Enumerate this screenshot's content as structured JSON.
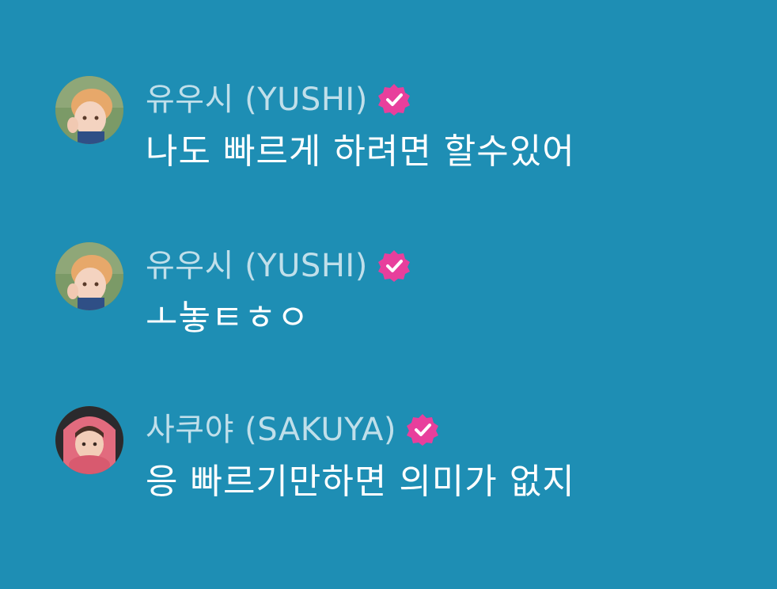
{
  "messages": [
    {
      "author": "유우시 (YUSHI)",
      "text": "나도 빠르게 하려면 할수있어",
      "verified": true
    },
    {
      "author": "유우시 (YUSHI)",
      "text": "ㅗ놓ㅌㅎㅇ",
      "verified": true
    },
    {
      "author": "사쿠야 (SAKUYA)",
      "text": "응 빠르기만하면 의미가 없지",
      "verified": true
    }
  ],
  "colors": {
    "background": "#1e8eb4",
    "badge": "#e83f9c",
    "author_text": "#b8dde9",
    "message_text": "#ffffff"
  },
  "icons": {
    "verified": "verified-badge-icon"
  }
}
